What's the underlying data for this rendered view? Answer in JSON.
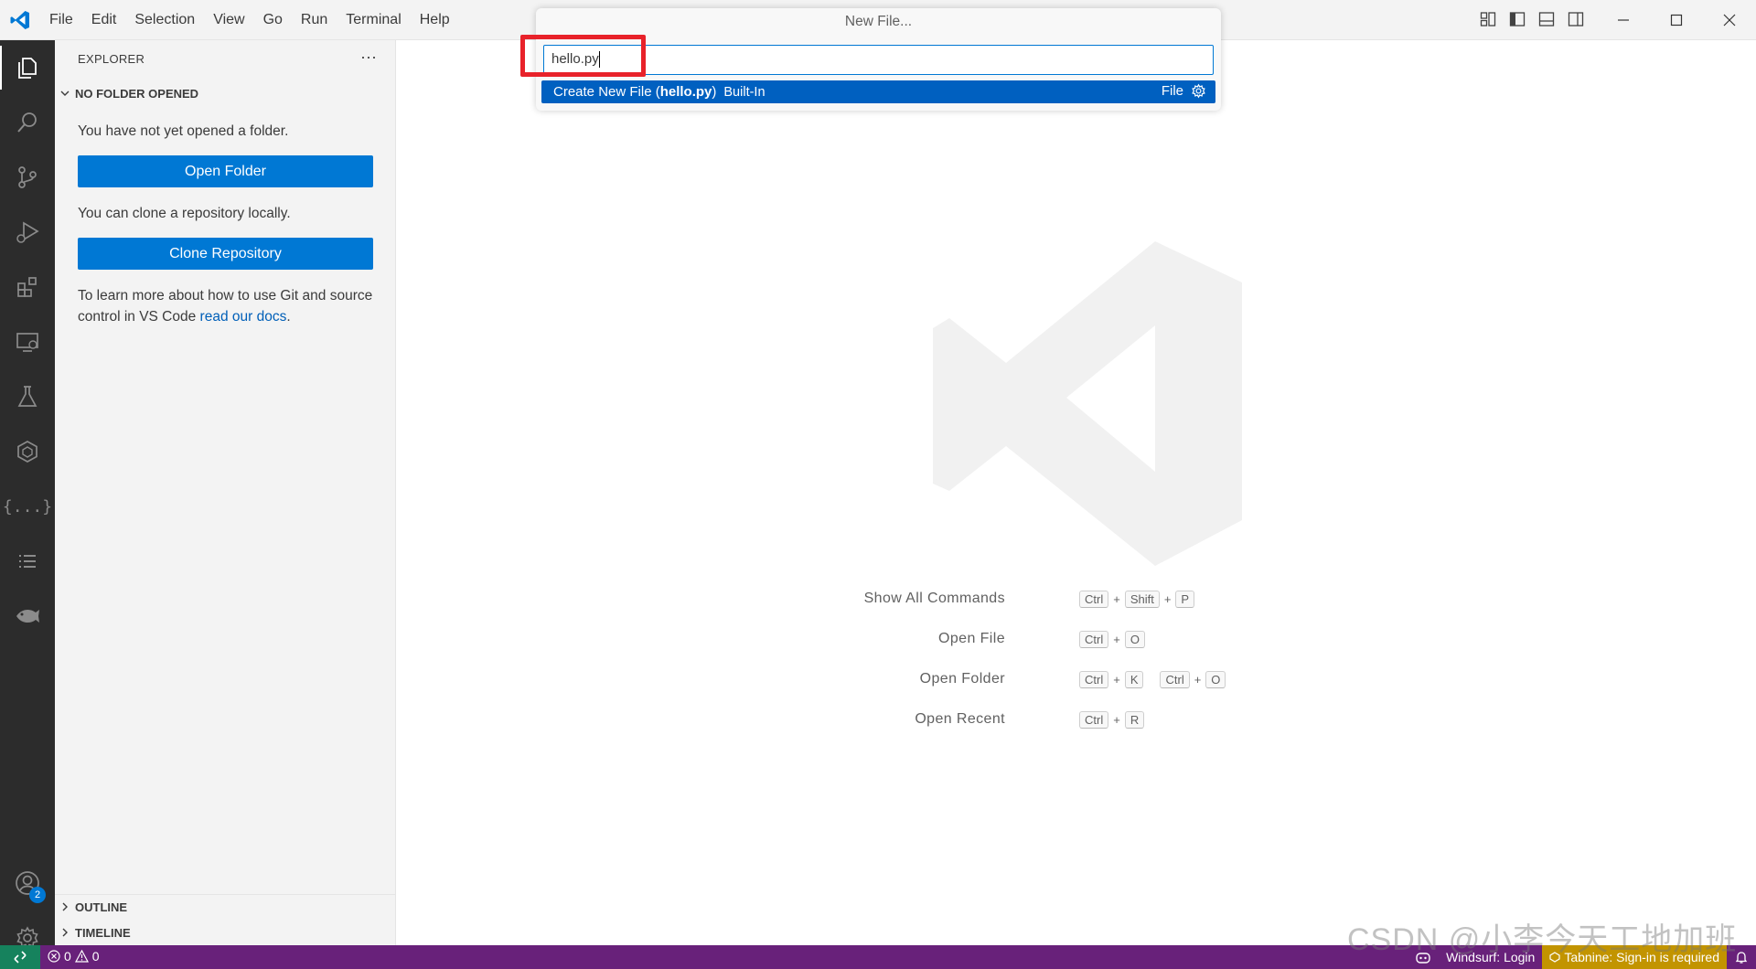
{
  "menubar": {
    "items": [
      "File",
      "Edit",
      "Selection",
      "View",
      "Go",
      "Run",
      "Terminal",
      "Help"
    ]
  },
  "activitybar": {
    "items": [
      "explorer-icon",
      "search-icon",
      "source-control-icon",
      "run-debug-icon",
      "extensions-icon",
      "remote-explorer-icon",
      "testing-icon",
      "docker-icon",
      "json-icon",
      "list-icon",
      "fish-icon"
    ],
    "accounts_badge": "2"
  },
  "sidebar": {
    "title": "EXPLORER",
    "section_title": "NO FOLDER OPENED",
    "no_folder_text": "You have not yet opened a folder.",
    "open_folder_button": "Open Folder",
    "clone_text": "You can clone a repository locally.",
    "clone_button": "Clone Repository",
    "docs_text": "To learn more about how to use Git and source control in VS Code ",
    "docs_link": "read our docs",
    "docs_suffix": ".",
    "outline": "OUTLINE",
    "timeline": "TIMELINE"
  },
  "quick_input": {
    "title": "New File...",
    "value": "hello.py",
    "item_prefix": "Create New File (",
    "item_name": "hello.py",
    "item_suffix": ")",
    "item_description": "Built-In",
    "item_right_label": "File"
  },
  "shortcuts": [
    {
      "label": "Show All Commands",
      "keys": [
        [
          "Ctrl",
          "Shift",
          "P"
        ]
      ]
    },
    {
      "label": "Open File",
      "keys": [
        [
          "Ctrl",
          "O"
        ]
      ]
    },
    {
      "label": "Open Folder",
      "keys": [
        [
          "Ctrl",
          "K"
        ],
        [
          "Ctrl",
          "O"
        ]
      ]
    },
    {
      "label": "Open Recent",
      "keys": [
        [
          "Ctrl",
          "R"
        ]
      ]
    }
  ],
  "statusbar": {
    "errors": "0",
    "warnings": "0",
    "windsurf": "Windsurf: Login",
    "tabnine": "Tabnine: Sign-in is required"
  },
  "watermark_text": "CSDN @小李今天工地加班",
  "colors": {
    "accent": "#0078d4",
    "statusbar": "#68217a",
    "remote": "#16825d",
    "highlight": "#e8222a",
    "tabnine": "#c29400"
  }
}
